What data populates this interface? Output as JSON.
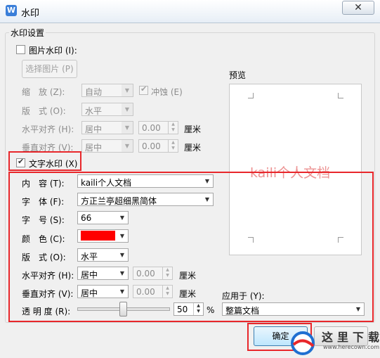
{
  "window": {
    "title": "水印",
    "app_icon_glyph": "W",
    "close_glyph": "✕"
  },
  "group": {
    "title": "水印设置"
  },
  "picture": {
    "checkbox_label": "图片水印 (I):",
    "select_button": "选择图片 (P)",
    "scale_label": "缩　放 (Z):",
    "scale_value": "自动",
    "washout_label": "冲蚀 (E)",
    "layout_label": "版　式 (O):",
    "layout_value": "水平",
    "halign_label": "水平对齐 (H):",
    "halign_value": "居中",
    "halign_offset": "0.00",
    "halign_unit": "厘米",
    "valign_label": "垂直对齐 (V):",
    "valign_value": "居中",
    "valign_offset": "0.00",
    "valign_unit": "厘米"
  },
  "text_wm": {
    "checkbox_label": "文字水印 (X)",
    "content_label": "内　容 (T):",
    "content_value": "kaili个人文档",
    "font_label": "字　体 (F):",
    "font_value": "方正兰亭超细黑简体",
    "size_label": "字　号 (S):",
    "size_value": "66",
    "color_label": "颜　色 (C):",
    "color_hex": "#ff0000",
    "layout_label": "版　式 (O):",
    "layout_value": "水平",
    "halign_label": "水平对齐 (H):",
    "halign_value": "居中",
    "halign_offset": "0.00",
    "halign_unit": "厘米",
    "valign_label": "垂直对齐 (V):",
    "valign_value": "居中",
    "valign_offset": "0.00",
    "valign_unit": "厘米",
    "transparency_label": "透 明 度 (R):",
    "transparency_value": "50",
    "transparency_unit": "%"
  },
  "preview": {
    "label": "预览",
    "watermark_text": "kaili个人文档"
  },
  "apply_to": {
    "label": "应用于 (Y):",
    "value": "整篇文档"
  },
  "buttons": {
    "ok": "确定"
  },
  "logo": {
    "text": "这里下载",
    "url": "www.herecown.com"
  },
  "colors": {
    "highlight": "#e8272b",
    "swatch": "#ff0000"
  }
}
